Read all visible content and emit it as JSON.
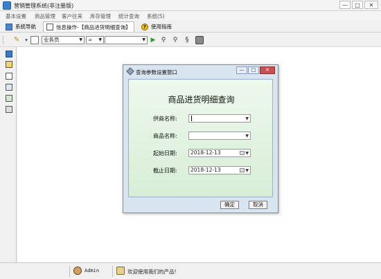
{
  "window": {
    "title": "营销管理系统(非注册版)",
    "min": "—",
    "max": "□",
    "close": "✕"
  },
  "menu": [
    "基本设置",
    "商品管理",
    "客户往来",
    "库存管理",
    "统计查询",
    "系统(S)"
  ],
  "tabs": [
    {
      "label": "系统导航",
      "icon": "nav-icon"
    },
    {
      "label": "信息操作-【商品进货明细查询】",
      "icon": "document-icon",
      "active": true
    },
    {
      "label": "使用指南",
      "icon": "help-icon"
    }
  ],
  "toolbar": {
    "field_select": "业务员",
    "operator_select": "=",
    "value_select": ""
  },
  "dialog": {
    "title": "查询参数设置窗口",
    "heading": "商品进货明细查询",
    "fields": [
      {
        "label": "供商名称:",
        "value": ""
      },
      {
        "label": "商品名称:",
        "value": ""
      },
      {
        "label": "起始日期:",
        "value": "2018-12-13"
      },
      {
        "label": "截止日期:",
        "value": "2018-12-13"
      }
    ],
    "ok": "确定",
    "cancel": "取消"
  },
  "status": {
    "user": "Admin",
    "message": "欢迎使用我们的产品!"
  },
  "colors": {
    "dialog_body": "#e4f3e3",
    "dialog_frame": "#d9e4f1",
    "accent": "#3a78c8"
  }
}
